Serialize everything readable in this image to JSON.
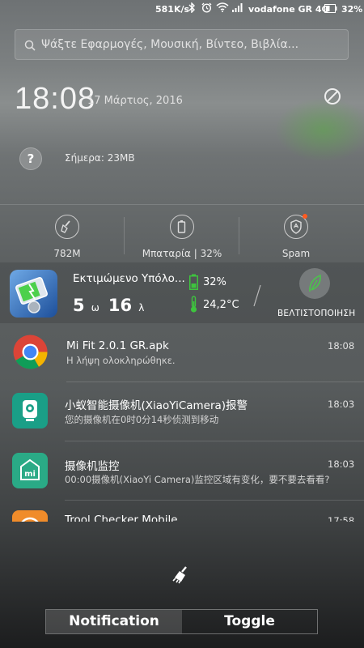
{
  "status_bar": {
    "speed": "581K/s",
    "carrier": "vodafone GR 4G",
    "battery_percent": "32%"
  },
  "search": {
    "placeholder": "Ψάξτε Εφαρμογές, Μουσική, Βίντεο, Βιβλία..."
  },
  "header": {
    "time": "18:08",
    "date": "17 Μάρτιος, 2016"
  },
  "today": {
    "icon": "?",
    "usage_label": "Σήμερα: 23MB"
  },
  "tools": [
    {
      "label": "782M",
      "icon": "broom-icon"
    },
    {
      "label": "Μπαταρία | 32%",
      "icon": "battery-icon"
    },
    {
      "label": "Spam",
      "icon": "shield-icon"
    }
  ],
  "battery_card": {
    "title": "Εκτιμώμενο Υπόλο...",
    "hours": "5",
    "hours_unit": "ω",
    "minutes": "16",
    "minutes_unit": "λ",
    "battery_level": "32%",
    "temperature": "24,2°C",
    "optimize_label": "ΒΕΛΤΙΣΤΟΠΟΙΗΣΗ"
  },
  "notifications": [
    {
      "title": "Mi Fit 2.0.1 GR.apk",
      "subtitle": "Η λήψη ολοκληρώθηκε.",
      "time": "18:08",
      "icon": "chrome-icon"
    },
    {
      "title": "小蚁智能摄像机(XiaoYiCamera)报警",
      "subtitle": "您的摄像机在0时0分14秒侦测到移动",
      "time": "18:03",
      "icon": "camera-app-icon"
    },
    {
      "title": "摄像机监控",
      "subtitle": "00:00摄像机(XiaoYi Camera)监控区域有变化，要不要去看看?",
      "time": "18:03",
      "icon": "mi-app-icon"
    },
    {
      "title": "Trool Checker Mobile",
      "subtitle": "",
      "time": "17:58",
      "icon": "orange-app-icon"
    }
  ],
  "bottom_tabs": {
    "notification": "Notification",
    "toggle": "Toggle"
  },
  "colors": {
    "battery_green": "#3ec43e",
    "notification_dot": "#ff5a1f"
  }
}
